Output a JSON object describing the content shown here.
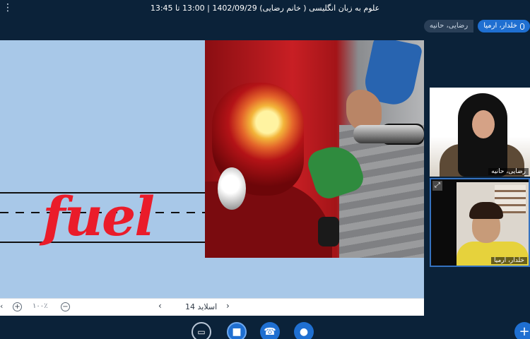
{
  "header": {
    "title": "علوم به زبان انگلیسی ( خانم رضایی) 1402/09/29 | 13:00 تا 13:45",
    "menu_icon": "more-dots-icon"
  },
  "talking_indicators": [
    {
      "name": "رضایی، حانیه",
      "active": false
    },
    {
      "name": "خلدار، ارمیا",
      "active": true
    }
  ],
  "presentation": {
    "slide_word": "fuel",
    "slide_label": "اسلاید 14",
    "zoom_value": "۱۰۰٪",
    "zoom_in": "+",
    "zoom_out": "−",
    "prev": "‹",
    "next": "›"
  },
  "webcams": [
    {
      "label": "رضایی، حانیه"
    },
    {
      "label": "خلدار، ارمیا"
    }
  ],
  "actions": {
    "screen_share": "▭",
    "video": "■",
    "phone": "☎",
    "mic": "●",
    "plus": "+"
  },
  "colors": {
    "background": "#0b2239",
    "accent": "#1f6fd1",
    "slide_bg": "#a8c8e8",
    "word": "#ea1c2a"
  }
}
